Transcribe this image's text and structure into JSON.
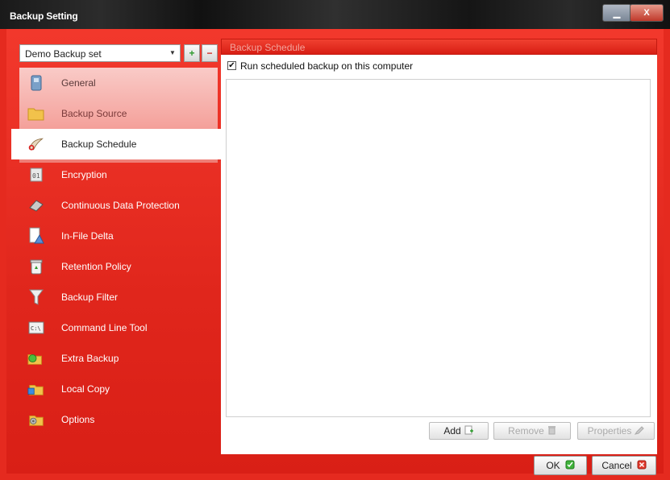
{
  "window": {
    "title": "Backup Setting",
    "minimize_icon": "minimize-icon",
    "close_icon": "close-icon"
  },
  "backup_set": {
    "selected": "Demo Backup set",
    "add_symbol": "+",
    "remove_symbol": "−"
  },
  "nav": {
    "items": [
      {
        "label": "General",
        "icon": "general-icon"
      },
      {
        "label": "Backup Source",
        "icon": "folder-icon"
      },
      {
        "label": "Backup Schedule",
        "icon": "schedule-icon"
      },
      {
        "label": "Encryption",
        "icon": "encryption-icon"
      },
      {
        "label": "Continuous Data Protection",
        "icon": "cdp-icon"
      },
      {
        "label": "In-File Delta",
        "icon": "delta-icon"
      },
      {
        "label": "Retention Policy",
        "icon": "recycle-bin-icon"
      },
      {
        "label": "Backup Filter",
        "icon": "filter-icon"
      },
      {
        "label": "Command Line Tool",
        "icon": "command-line-icon"
      },
      {
        "label": "Extra Backup",
        "icon": "extra-backup-icon"
      },
      {
        "label": "Local Copy",
        "icon": "local-copy-icon"
      },
      {
        "label": "Options",
        "icon": "options-icon"
      }
    ],
    "selected_index": 2
  },
  "schedule": {
    "header": "Backup Schedule",
    "run_checkbox_label": "Run scheduled backup on this computer",
    "run_checked": true,
    "add_label": "Add",
    "remove_label": "Remove",
    "properties_label": "Properties"
  },
  "footer": {
    "ok_label": "OK",
    "cancel_label": "Cancel"
  },
  "colors": {
    "accent": "#e52a1f",
    "titlebar": "#1e1e1e"
  }
}
